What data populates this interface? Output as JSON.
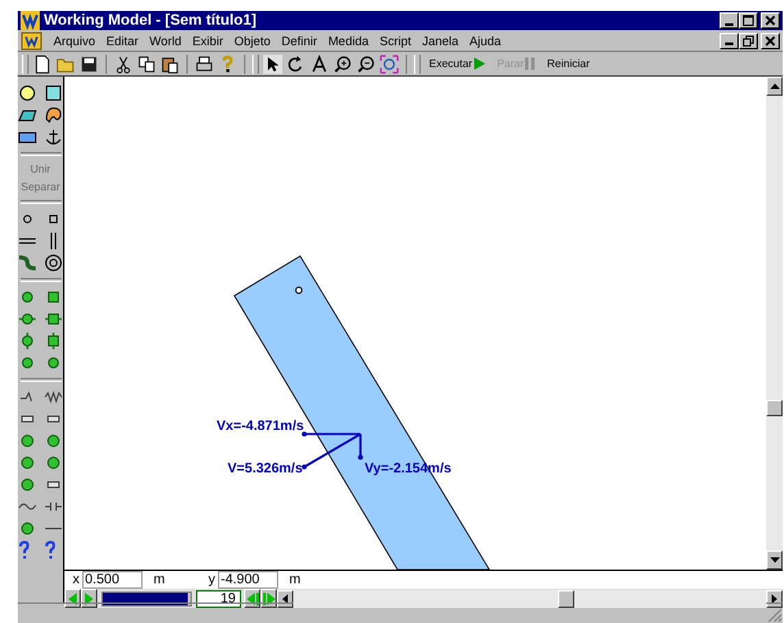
{
  "window": {
    "title": "Working Model - [Sem título1]"
  },
  "menu": [
    "Arquivo",
    "Editar",
    "World",
    "Exibir",
    "Objeto",
    "Definir",
    "Medida",
    "Script",
    "Janela",
    "Ajuda"
  ],
  "toolbar": {
    "run_buttons": [
      {
        "label": "Executar",
        "kind": "run",
        "disabled": false
      },
      {
        "label": "Parar",
        "kind": "pause",
        "disabled": true
      },
      {
        "label": "Reiniciar",
        "kind": "reset",
        "disabled": false
      }
    ]
  },
  "palette": {
    "join_buttons": [
      {
        "label": "Unir",
        "disabled": true
      },
      {
        "label": "Separar",
        "disabled": true
      }
    ]
  },
  "canvas": {
    "vectors": [
      {
        "label": "Vx=-4.871m/s",
        "kind": "vx"
      },
      {
        "label": "V=5.326m/s",
        "kind": "v"
      },
      {
        "label": "Vy=-2.154m/s",
        "kind": "vy"
      }
    ]
  },
  "coordinates": {
    "x_label": "x",
    "x_value": "0.500",
    "x_unit": "m",
    "y_label": "y",
    "y_value": "-4.900",
    "y_unit": "m"
  },
  "playback": {
    "level": 0.97,
    "frame": "19"
  }
}
